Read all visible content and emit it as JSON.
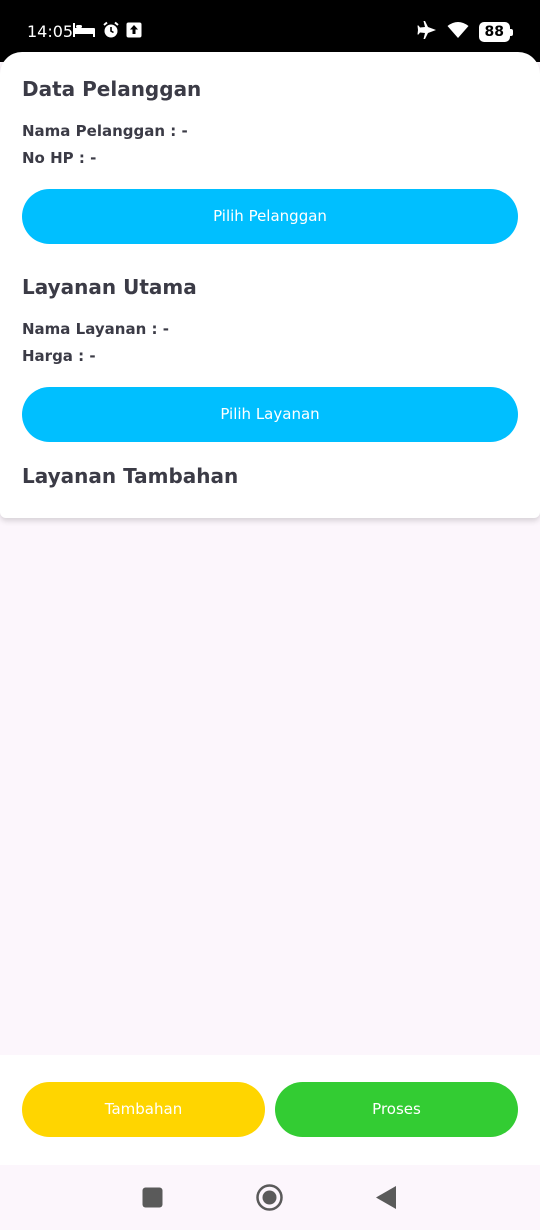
{
  "status_bar": {
    "time": "14:05",
    "battery": "88"
  },
  "customer": {
    "title": "Data Pelanggan",
    "name_line": "Nama Pelanggan : -",
    "phone_line": "No HP : -",
    "button_label": "Pilih Pelanggan"
  },
  "main_service": {
    "title": "Layanan Utama",
    "name_line": "Nama Layanan : -",
    "price_line": "Harga : -",
    "button_label": "Pilih Layanan"
  },
  "extra_service": {
    "title": "Layanan Tambahan"
  },
  "actions": {
    "extra_label": "Tambahan",
    "process_label": "Proses",
    "extra_color": "#ffd500",
    "process_color": "#33cc33"
  },
  "colors": {
    "primary_button": "#00bfff",
    "background": "#fcf6fc"
  }
}
